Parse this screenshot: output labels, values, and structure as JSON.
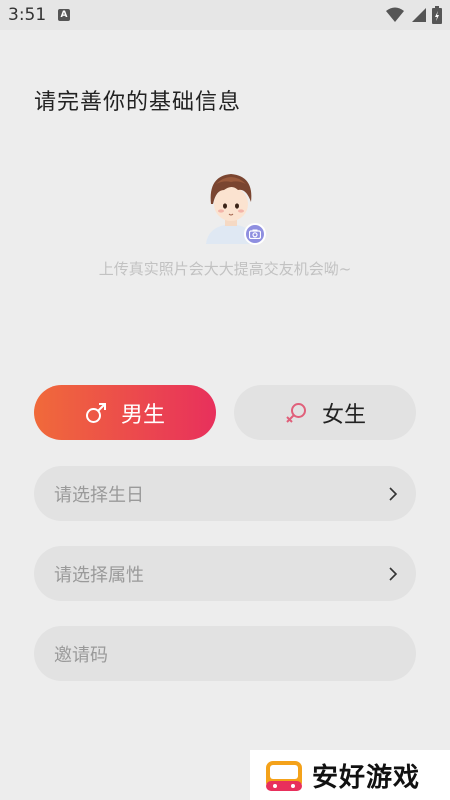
{
  "status_bar": {
    "time": "3:51",
    "app_icon_letter": "A"
  },
  "header": {
    "title": "请完善你的基础信息"
  },
  "avatar": {
    "hint": "上传真实照片会大大提高交友机会呦~"
  },
  "gender": {
    "male_label": "男生",
    "female_label": "女生"
  },
  "form": {
    "birthday_placeholder": "请选择生日",
    "attribute_placeholder": "请选择属性",
    "invite_placeholder": "邀请码"
  },
  "watermark": {
    "text": "安好游戏"
  },
  "colors": {
    "accent_start": "#f06a3a",
    "accent_end": "#e8305c",
    "female_icon": "#e0607a"
  }
}
